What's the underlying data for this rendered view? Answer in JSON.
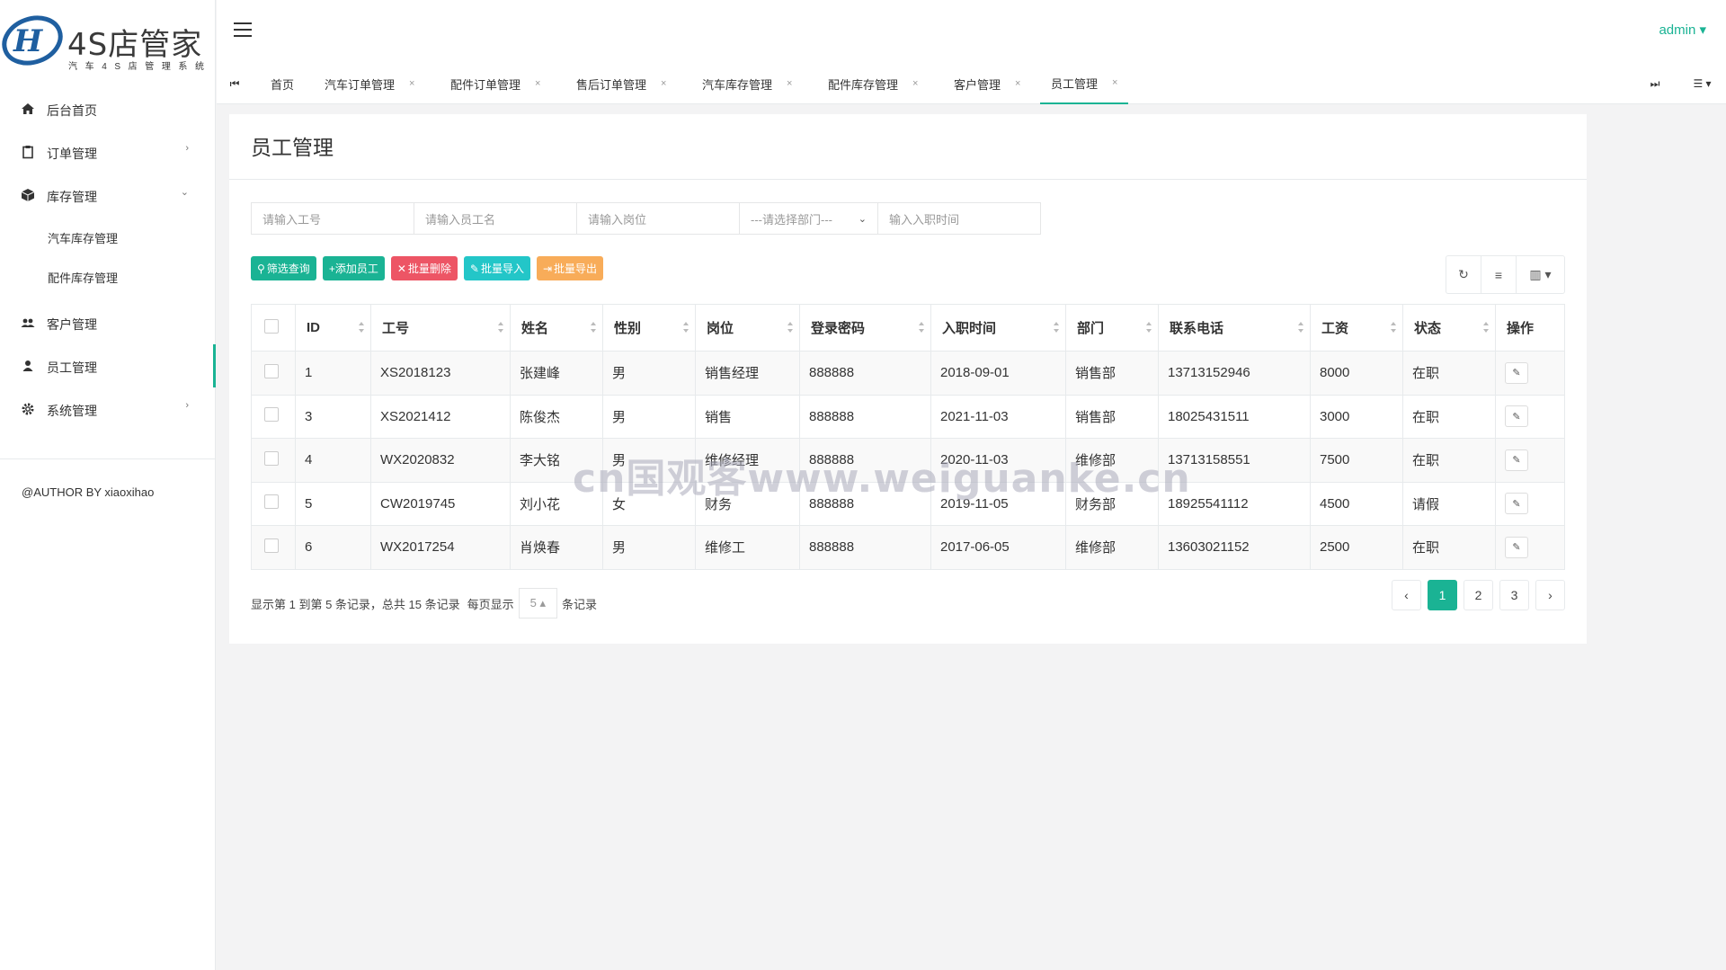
{
  "brand": {
    "title": "4S店管家",
    "subtitle": "汽车4S店管理系统"
  },
  "sidebar": {
    "items": [
      {
        "label": "后台首页",
        "icon": "home-icon"
      },
      {
        "label": "订单管理",
        "icon": "clipboard-icon",
        "arrow": "›"
      },
      {
        "label": "库存管理",
        "icon": "cube-icon",
        "arrow": "⌄"
      },
      {
        "label": "客户管理",
        "icon": "users-icon"
      },
      {
        "label": "员工管理",
        "icon": "user-icon"
      },
      {
        "label": "系统管理",
        "icon": "gear-icon",
        "arrow": "›"
      }
    ],
    "submenu": [
      "汽车库存管理",
      "配件库存管理"
    ],
    "author": "@AUTHOR BY xiaoxihao"
  },
  "header": {
    "user": "admin ▾",
    "accent": "#1ab394"
  },
  "tabs": [
    "首页",
    "汽车订单管理",
    "配件订单管理",
    "售后订单管理",
    "汽车库存管理",
    "配件库存管理",
    "客户管理",
    "员工管理"
  ],
  "tab_close": "×",
  "panel": {
    "title": "员工管理"
  },
  "filters": {
    "job_no": "请输入工号",
    "name": "请输入员工名",
    "post": "请输入岗位",
    "dept": "---请选择部门---",
    "date": "输入入职时间"
  },
  "buttons": {
    "search": "筛选查询",
    "add": "+添加员工",
    "delete": "批量删除",
    "import": "批量导入",
    "export": "批量导出"
  },
  "table": {
    "headers": [
      "ID",
      "工号",
      "姓名",
      "性别",
      "岗位",
      "登录密码",
      "入职时间",
      "部门",
      "联系电话",
      "工资",
      "状态",
      "操作"
    ],
    "rows": [
      [
        "1",
        "XS2018123",
        "张建峰",
        "男",
        "销售经理",
        "888888",
        "2018-09-01",
        "销售部",
        "13713152946",
        "8000",
        "在职"
      ],
      [
        "3",
        "XS2021412",
        "陈俊杰",
        "男",
        "销售",
        "888888",
        "2021-11-03",
        "销售部",
        "18025431511",
        "3000",
        "在职"
      ],
      [
        "4",
        "WX2020832",
        "李大铭",
        "男",
        "维修经理",
        "888888",
        "2020-11-03",
        "维修部",
        "13713158551",
        "7500",
        "在职"
      ],
      [
        "5",
        "CW2019745",
        "刘小花",
        "女",
        "财务",
        "888888",
        "2019-11-05",
        "财务部",
        "18925541112",
        "4500",
        "请假"
      ],
      [
        "6",
        "WX2017254",
        "肖焕春",
        "男",
        "维修工",
        "888888",
        "2017-06-05",
        "维修部",
        "13603021152",
        "2500",
        "在职"
      ]
    ]
  },
  "pagination": {
    "info": "显示第 1 到第 5 条记录，总共 15 条记录",
    "per_page_label": "每页显示",
    "per_page": "5 ▴",
    "suffix": "条记录",
    "prev": "‹",
    "pages": [
      "1",
      "2",
      "3"
    ],
    "next": "›",
    "current": "1"
  },
  "watermark": "cn国观客www.weiguanke.cn"
}
